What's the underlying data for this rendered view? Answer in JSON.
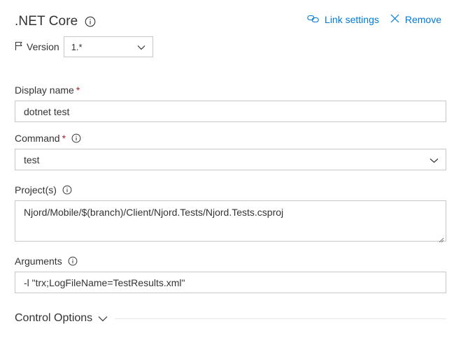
{
  "header": {
    "title": ".NET Core",
    "actions": [
      {
        "label": "Link settings",
        "icon": "link-icon"
      },
      {
        "label": "Remove",
        "icon": "close-icon"
      }
    ]
  },
  "version": {
    "label": "Version",
    "value": "1.*"
  },
  "fields": {
    "display_name": {
      "label": "Display name",
      "required_mark": "*",
      "value": "dotnet test"
    },
    "command": {
      "label": "Command",
      "required_mark": "*",
      "value": "test"
    },
    "projects": {
      "label": "Project(s)",
      "value": "Njord/Mobile/$(branch)/Client/Njord.Tests/Njord.Tests.csproj"
    },
    "arguments": {
      "label": "Arguments",
      "value": "-l \"trx;LogFileName=TestResults.xml\""
    }
  },
  "control_options": {
    "label": "Control Options"
  },
  "colors": {
    "accent": "#0078d4",
    "required": "#a4262c",
    "border": "#c8c8c8",
    "text": "#333333"
  }
}
